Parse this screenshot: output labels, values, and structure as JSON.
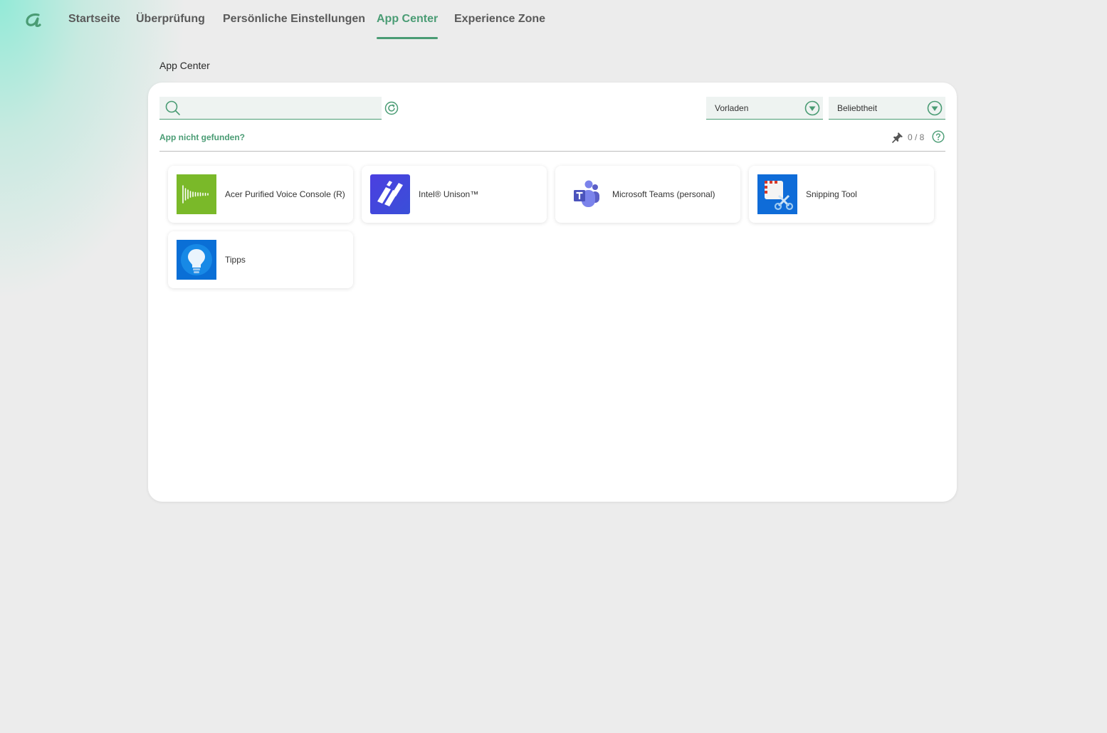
{
  "nav": {
    "tabs": [
      {
        "label": "Startseite"
      },
      {
        "label": "Überprüfung"
      },
      {
        "label": "Persönliche Einstellungen"
      },
      {
        "label": "App Center"
      },
      {
        "label": "Experience Zone"
      }
    ],
    "active_tab": "App Center"
  },
  "page": {
    "title": "App Center"
  },
  "toolbar": {
    "search_value": "",
    "filter_label": "Vorladen",
    "sort_label": "Beliebtheit"
  },
  "notfound_link": "App nicht gefunden?",
  "pin_counter": "0 / 8",
  "apps": [
    {
      "name": "Acer Purified Voice Console (R)",
      "icon": "acer-purified-voice-icon"
    },
    {
      "name": "Intel® Unison™",
      "icon": "intel-unison-icon"
    },
    {
      "name": "Microsoft Teams (personal)",
      "icon": "microsoft-teams-icon"
    },
    {
      "name": "Snipping Tool",
      "icon": "snipping-tool-icon"
    },
    {
      "name": "Tipps",
      "icon": "tips-lightbulb-icon"
    }
  ],
  "colors": {
    "accent": "#4a9c74",
    "background": "#ececec",
    "panel": "#ffffff"
  }
}
